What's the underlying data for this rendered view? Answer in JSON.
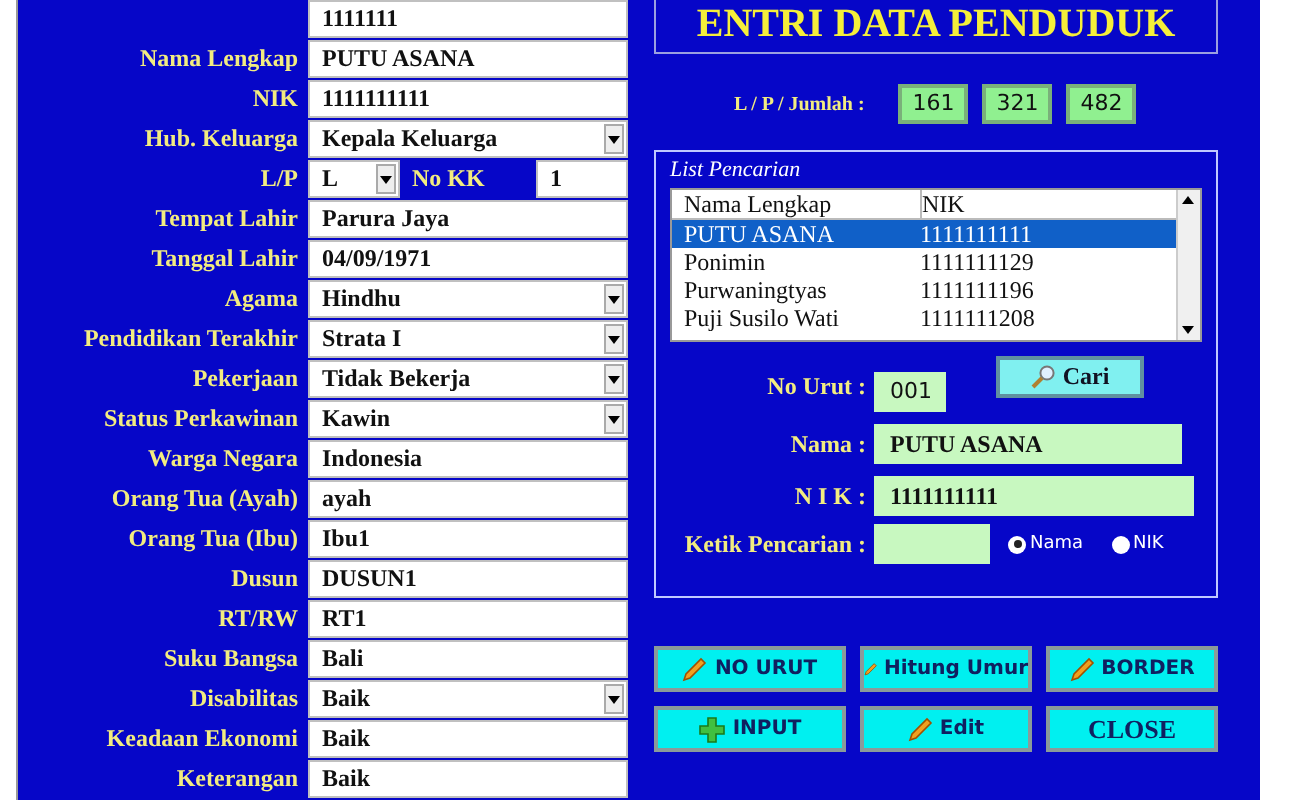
{
  "form_fields": [
    {
      "kind": "text",
      "value": "1111111"
    },
    {
      "kind": "text",
      "label": "Nama Lengkap",
      "value": "PUTU ASANA"
    },
    {
      "kind": "text",
      "label": "NIK",
      "value": "1111111111"
    },
    {
      "kind": "select",
      "label": "Hub.  Keluarga",
      "value": "Kepala Keluarga"
    },
    {
      "kind": "pair",
      "label": "L/P",
      "value": "L",
      "extra_label": "No KK",
      "extra_value": "1"
    },
    {
      "kind": "text",
      "label": "Tempat Lahir",
      "value": "Parura Jaya"
    },
    {
      "kind": "text",
      "label": "Tanggal  Lahir",
      "value": "04/09/1971"
    },
    {
      "kind": "select",
      "label": "Agama",
      "value": "Hindhu"
    },
    {
      "kind": "select",
      "label": "Pendidikan Terakhir",
      "value": "Strata I"
    },
    {
      "kind": "select",
      "label": "Pekerjaan",
      "value": "Tidak Bekerja"
    },
    {
      "kind": "select",
      "label": "Status Perkawinan",
      "value": "Kawin"
    },
    {
      "kind": "text",
      "label": "Warga Negara",
      "value": "Indonesia"
    },
    {
      "kind": "text",
      "label": "Orang Tua (Ayah)",
      "value": "ayah"
    },
    {
      "kind": "text",
      "label": "Orang Tua (Ibu)",
      "value": "Ibu1"
    },
    {
      "kind": "text",
      "label": "Dusun",
      "value": "DUSUN1"
    },
    {
      "kind": "text",
      "label": "RT/RW",
      "value": "RT1"
    },
    {
      "kind": "text",
      "label": "Suku Bangsa",
      "value": "Bali"
    },
    {
      "kind": "select",
      "label": "Disabilitas",
      "value": "Baik"
    },
    {
      "kind": "text",
      "label": "Keadaan Ekonomi",
      "value": "Baik"
    },
    {
      "kind": "text",
      "label": "Keterangan",
      "value": "Baik"
    }
  ],
  "title": "ENTRI DATA PENDUDUK",
  "stats": {
    "label": "L / P / Jumlah :",
    "values": [
      "161",
      "321",
      "482"
    ]
  },
  "search_group": {
    "title": "List Pencarian",
    "columns": [
      "Nama Lengkap",
      "NIK"
    ],
    "rows": [
      {
        "name": "PUTU ASANA",
        "nik": "1111111111",
        "selected": true
      },
      {
        "name": "Ponimin",
        "nik": "1111111129",
        "selected": false
      },
      {
        "name": "Purwaningtyas",
        "nik": "1111111196",
        "selected": false
      },
      {
        "name": "Puji Susilo Wati",
        "nik": "1111111208",
        "selected": false
      }
    ],
    "no_urut": {
      "label": "No Urut :",
      "value": "001"
    },
    "search_button": "Cari",
    "nama": {
      "label": "Nama :",
      "value": "PUTU ASANA"
    },
    "nik": {
      "label": "N I K :",
      "value": "1111111111"
    },
    "search_input": {
      "label": "Ketik Pencarian :"
    },
    "radios": [
      {
        "label": "Nama",
        "selected": true
      },
      {
        "label": "NIK",
        "selected": false
      }
    ]
  },
  "buttons": [
    {
      "label": "NO URUT",
      "kind": "pencil"
    },
    {
      "label": "Hitung Umur",
      "kind": "pencil"
    },
    {
      "label": "BORDER",
      "kind": "pencil"
    },
    {
      "label": "INPUT",
      "kind": "add"
    },
    {
      "label": "Edit",
      "kind": "pencil"
    },
    {
      "label": "CLOSE",
      "kind": "plain"
    }
  ]
}
